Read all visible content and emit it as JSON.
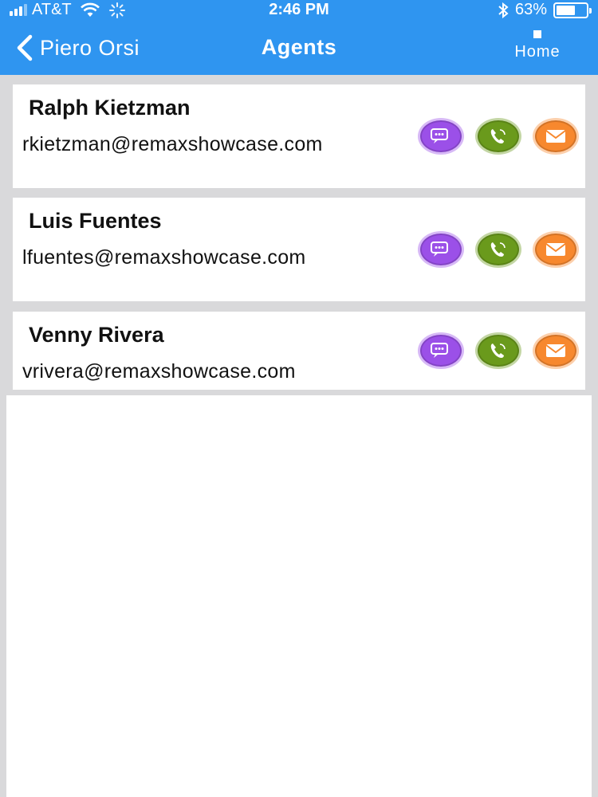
{
  "status_bar": {
    "carrier": "AT&T",
    "time": "2:46 PM",
    "battery_percent": "63%",
    "battery_level": 0.63
  },
  "nav": {
    "back_label": "Piero Orsi",
    "title": "Agents",
    "home_label": "Home"
  },
  "colors": {
    "nav_background": "#2f95f0",
    "chat_button": "#9b50e8",
    "call_button": "#6a9a1c",
    "email_button": "#f7882e"
  },
  "agents": [
    {
      "name": "Ralph Kietzman",
      "email": "rkietzman@remaxshowcase.com"
    },
    {
      "name": "Luis Fuentes",
      "email": "lfuentes@remaxshowcase.com"
    },
    {
      "name": "Venny Rivera",
      "email": "vrivera@remaxshowcase.com"
    }
  ],
  "action_icons": [
    "chat-icon",
    "phone-icon",
    "mail-icon"
  ]
}
